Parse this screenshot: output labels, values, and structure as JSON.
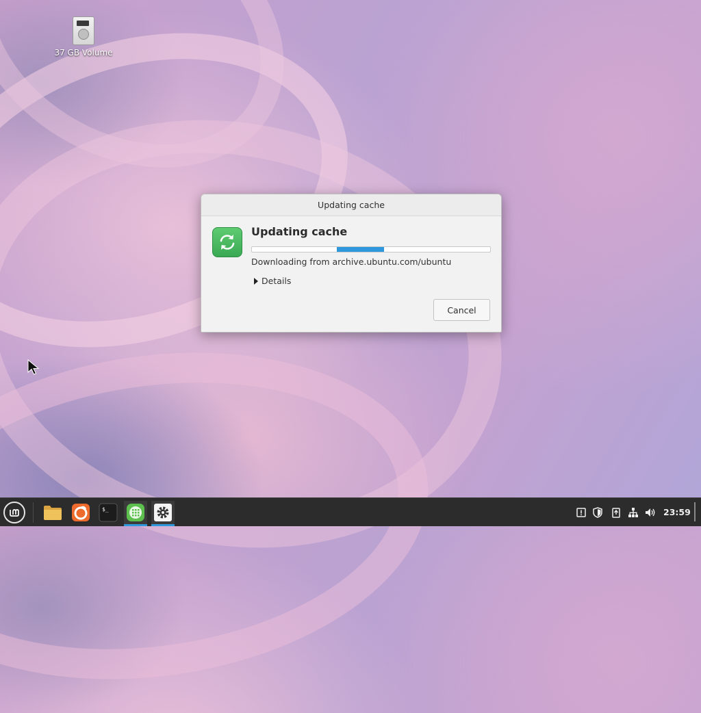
{
  "desktop": {
    "icons": [
      {
        "label": "37 GB Volume",
        "icon": "drive-icon"
      }
    ]
  },
  "dialog": {
    "window_title": "Updating cache",
    "heading": "Updating cache",
    "status": "Downloading from archive.ubuntu.com/ubuntu",
    "details_label": "Details",
    "cancel_label": "Cancel",
    "progress": {
      "indeterminate": true
    },
    "icon": "refresh-icon",
    "accent_color": "#2f97dc",
    "icon_color": "#3aa954"
  },
  "taskbar": {
    "menu_icon": "mint-menu-icon",
    "launchers": [
      {
        "name": "files",
        "icon": "folder-icon"
      },
      {
        "name": "firefox",
        "icon": "firefox-icon"
      },
      {
        "name": "terminal",
        "icon": "terminal-icon"
      },
      {
        "name": "software-manager",
        "icon": "grid-icon"
      },
      {
        "name": "update-manager",
        "icon": "gear-icon"
      }
    ],
    "tray_icons": [
      "update-notice-icon",
      "shield-icon",
      "clipboard-icon",
      "network-icon",
      "volume-icon"
    ],
    "clock": "23:59"
  }
}
